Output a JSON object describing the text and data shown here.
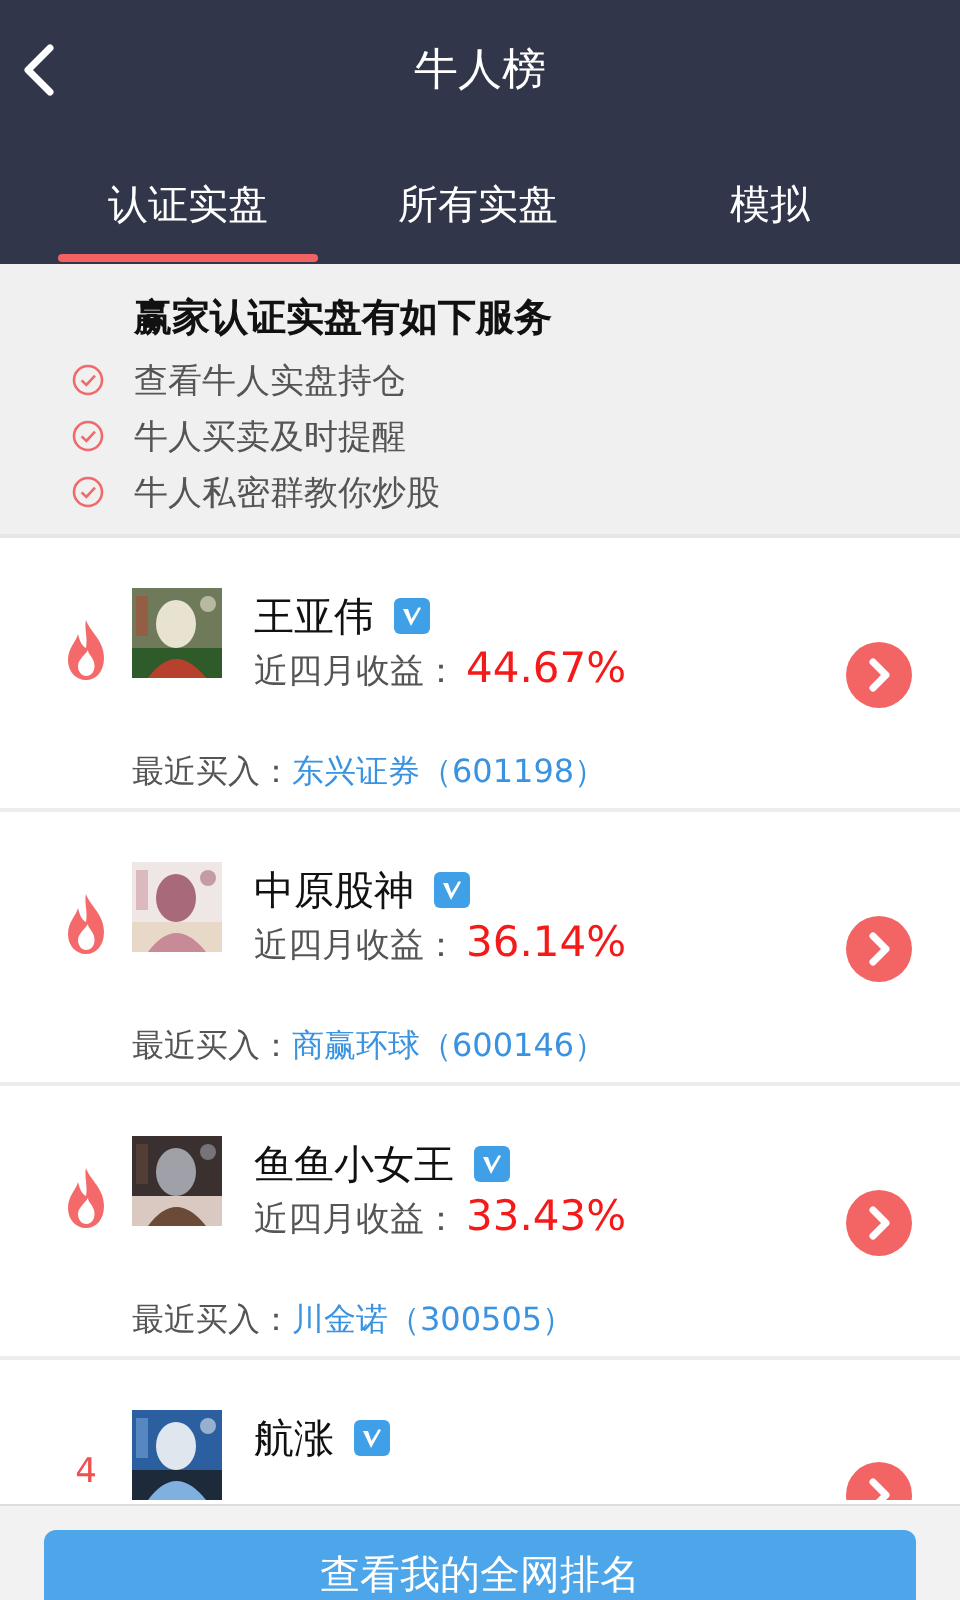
{
  "header": {
    "title": "牛人榜"
  },
  "tabs": [
    {
      "label": "认证实盘",
      "selected": true
    },
    {
      "label": "所有实盘",
      "selected": false
    },
    {
      "label": "模拟",
      "selected": false
    }
  ],
  "services": {
    "title": "赢家认证实盘有如下服务",
    "items": [
      "查看牛人实盘持仓",
      "牛人买卖及时提醒",
      "牛人私密群教你炒股"
    ]
  },
  "traders": [
    {
      "kind": "flame",
      "name": "王亚伟",
      "verified": true,
      "return_label": "近四月收益：",
      "return": "44.67%",
      "buy_label": "最近买入：",
      "buy_stock": "东兴证券（601198）"
    },
    {
      "kind": "flame",
      "name": "中原股神",
      "verified": true,
      "return_label": "近四月收益：",
      "return": "36.14%",
      "buy_label": "最近买入：",
      "buy_stock": "商赢环球（600146）"
    },
    {
      "kind": "flame",
      "name": "鱼鱼小女王",
      "verified": true,
      "return_label": "近四月收益：",
      "return": "33.43%",
      "buy_label": "最近买入：",
      "buy_stock": "川金诺（300505）"
    },
    {
      "kind": "number",
      "rank": "4",
      "name": "航涨",
      "verified": true
    }
  ],
  "bottom_button": "查看我的全网排名"
}
